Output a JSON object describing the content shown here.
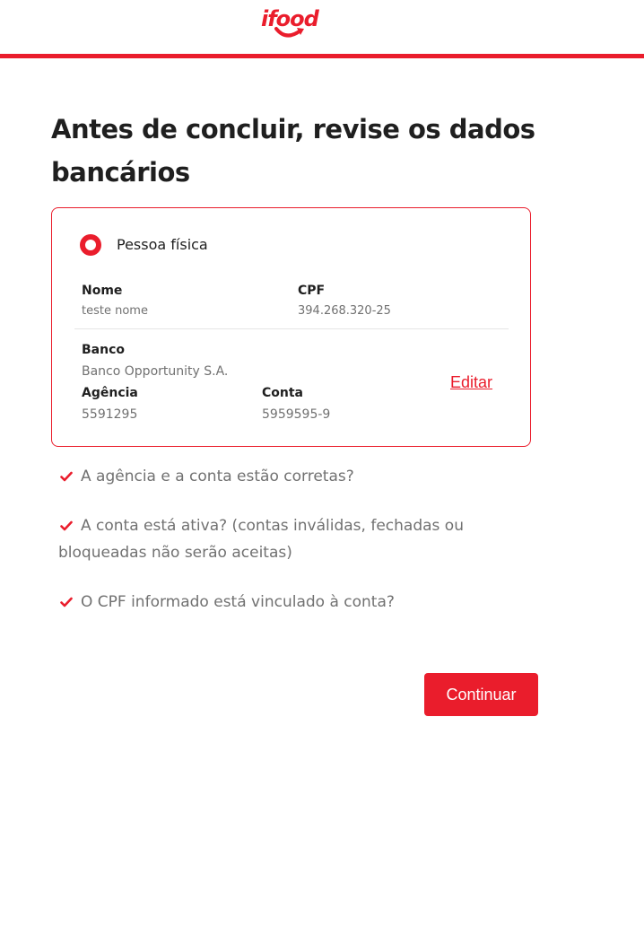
{
  "header": {
    "logo_text": "ifood",
    "brand_color": "#ea1d2c"
  },
  "page": {
    "title": "Antes de concluir, revise os dados bancários"
  },
  "card": {
    "person_type": "Pessoa física",
    "name_label": "Nome",
    "name_value": "teste nome",
    "cpf_label": "CPF",
    "cpf_value": "394.268.320-25",
    "bank_label": "Banco",
    "bank_value": "Banco Opportunity S.A.",
    "agency_label": "Agência",
    "agency_value": "5591295",
    "account_label": "Conta",
    "account_value": "5959595-9",
    "edit_label": "Editar"
  },
  "checklist": [
    "A agência e a conta estão corretas?",
    "A conta está ativa? (contas inválidas, fechadas ou bloqueadas não serão aceitas)",
    "O CPF informado está vinculado à conta?"
  ],
  "actions": {
    "continue_label": "Continuar"
  },
  "icons": {
    "check": "check-icon",
    "radio": "radio-selected-icon",
    "logo": "ifood-logo"
  }
}
